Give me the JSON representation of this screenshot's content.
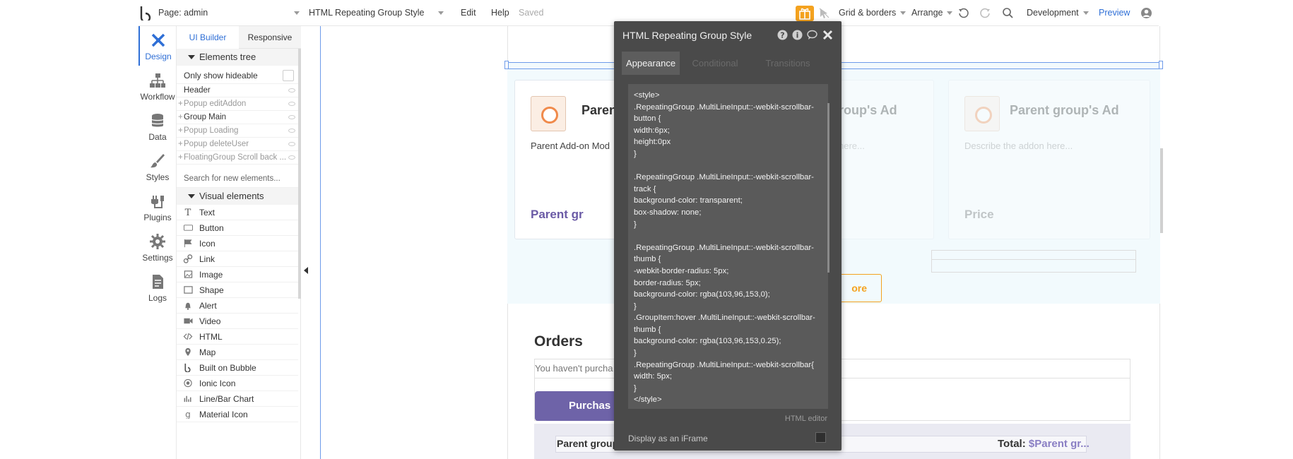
{
  "topbar": {
    "page_label": "Page: admin",
    "element_label": "HTML Repeating Group Style",
    "edit": "Edit",
    "help": "Help",
    "saved": "Saved",
    "grid": "Grid & borders",
    "arrange": "Arrange",
    "env": "Development",
    "preview": "Preview"
  },
  "rail": [
    {
      "label": "Design"
    },
    {
      "label": "Workflow"
    },
    {
      "label": "Data"
    },
    {
      "label": "Styles"
    },
    {
      "label": "Plugins"
    },
    {
      "label": "Settings"
    },
    {
      "label": "Logs"
    }
  ],
  "panel": {
    "tab_builder": "UI Builder",
    "tab_responsive": "Responsive",
    "tree_header": "Elements tree",
    "only_hideable": "Only show hideable",
    "tree": [
      {
        "label": "Header",
        "dim": false,
        "plus": false
      },
      {
        "label": "Popup editAddon",
        "dim": true,
        "plus": true
      },
      {
        "label": "Group Main",
        "dim": false,
        "plus": true
      },
      {
        "label": "Popup Loading",
        "dim": true,
        "plus": true
      },
      {
        "label": "Popup deleteUser",
        "dim": true,
        "plus": true
      },
      {
        "label": "FloatingGroup Scroll back ...",
        "dim": true,
        "plus": true
      }
    ],
    "search_placeholder": "Search for new elements...",
    "visual_header": "Visual elements",
    "visual": [
      {
        "label": "Text",
        "icon": "text-icon"
      },
      {
        "label": "Button",
        "icon": "button-icon"
      },
      {
        "label": "Icon",
        "icon": "flag-icon"
      },
      {
        "label": "Link",
        "icon": "link-icon"
      },
      {
        "label": "Image",
        "icon": "image-icon"
      },
      {
        "label": "Shape",
        "icon": "shape-icon"
      },
      {
        "label": "Alert",
        "icon": "bell-icon"
      },
      {
        "label": "Video",
        "icon": "video-icon"
      },
      {
        "label": "HTML",
        "icon": "code-icon"
      },
      {
        "label": "Map",
        "icon": "map-pin-icon"
      },
      {
        "label": "Built on Bubble",
        "icon": "bubble-logo-icon"
      },
      {
        "label": "Ionic Icon",
        "icon": "ionic-icon"
      },
      {
        "label": "Line/Bar Chart",
        "icon": "chart-icon"
      },
      {
        "label": "Material Icon",
        "icon": "material-icon"
      }
    ]
  },
  "canvas": {
    "card1_title": "Parent",
    "card1_desc": "Parent Add-on Mod",
    "card1_price": "Parent gr",
    "card2_title": "roup's Ad",
    "card2_desc": "here...",
    "card3_title": "Parent group's Ad",
    "card3_desc": "Describe the addon here...",
    "card3_price": "Price",
    "more_label": "ore",
    "orders_title": "Orders",
    "orders_empty": "You haven't purcha",
    "purchase_label": "Purchas",
    "bottom_parent": "Parent group",
    "total_label": "Total:",
    "total_value": "$Parent gr..."
  },
  "popup": {
    "title": "HTML Repeating Group Style",
    "tabs": [
      "Appearance",
      "Conditional",
      "Transitions"
    ],
    "code": "<style>\n.RepeatingGroup .MultiLineInput::-webkit-scrollbar-button {\nwidth:6px;\nheight:0px\n}\n\n.RepeatingGroup .MultiLineInput::-webkit-scrollbar-track {\nbackground-color: transparent;\nbox-shadow: none;\n}\n\n.RepeatingGroup .MultiLineInput::-webkit-scrollbar-thumb {\n-webkit-border-radius: 5px;\nborder-radius: 5px;\nbackground-color: rgba(103,96,153,0);\n}\n.GroupItem:hover .MultiLineInput::-webkit-scrollbar-thumb {\nbackground-color: rgba(103,96,153,0.25);\n}\n.RepeatingGroup .MultiLineInput::-webkit-scrollbar{\nwidth: 5px;\n}\n</style>",
    "editor_label": "HTML editor",
    "iframe_label": "Display as an iFrame"
  },
  "colors": {
    "accent": "#2f6fd6",
    "orange": "#f4a21f",
    "purple": "#6e63a8"
  }
}
